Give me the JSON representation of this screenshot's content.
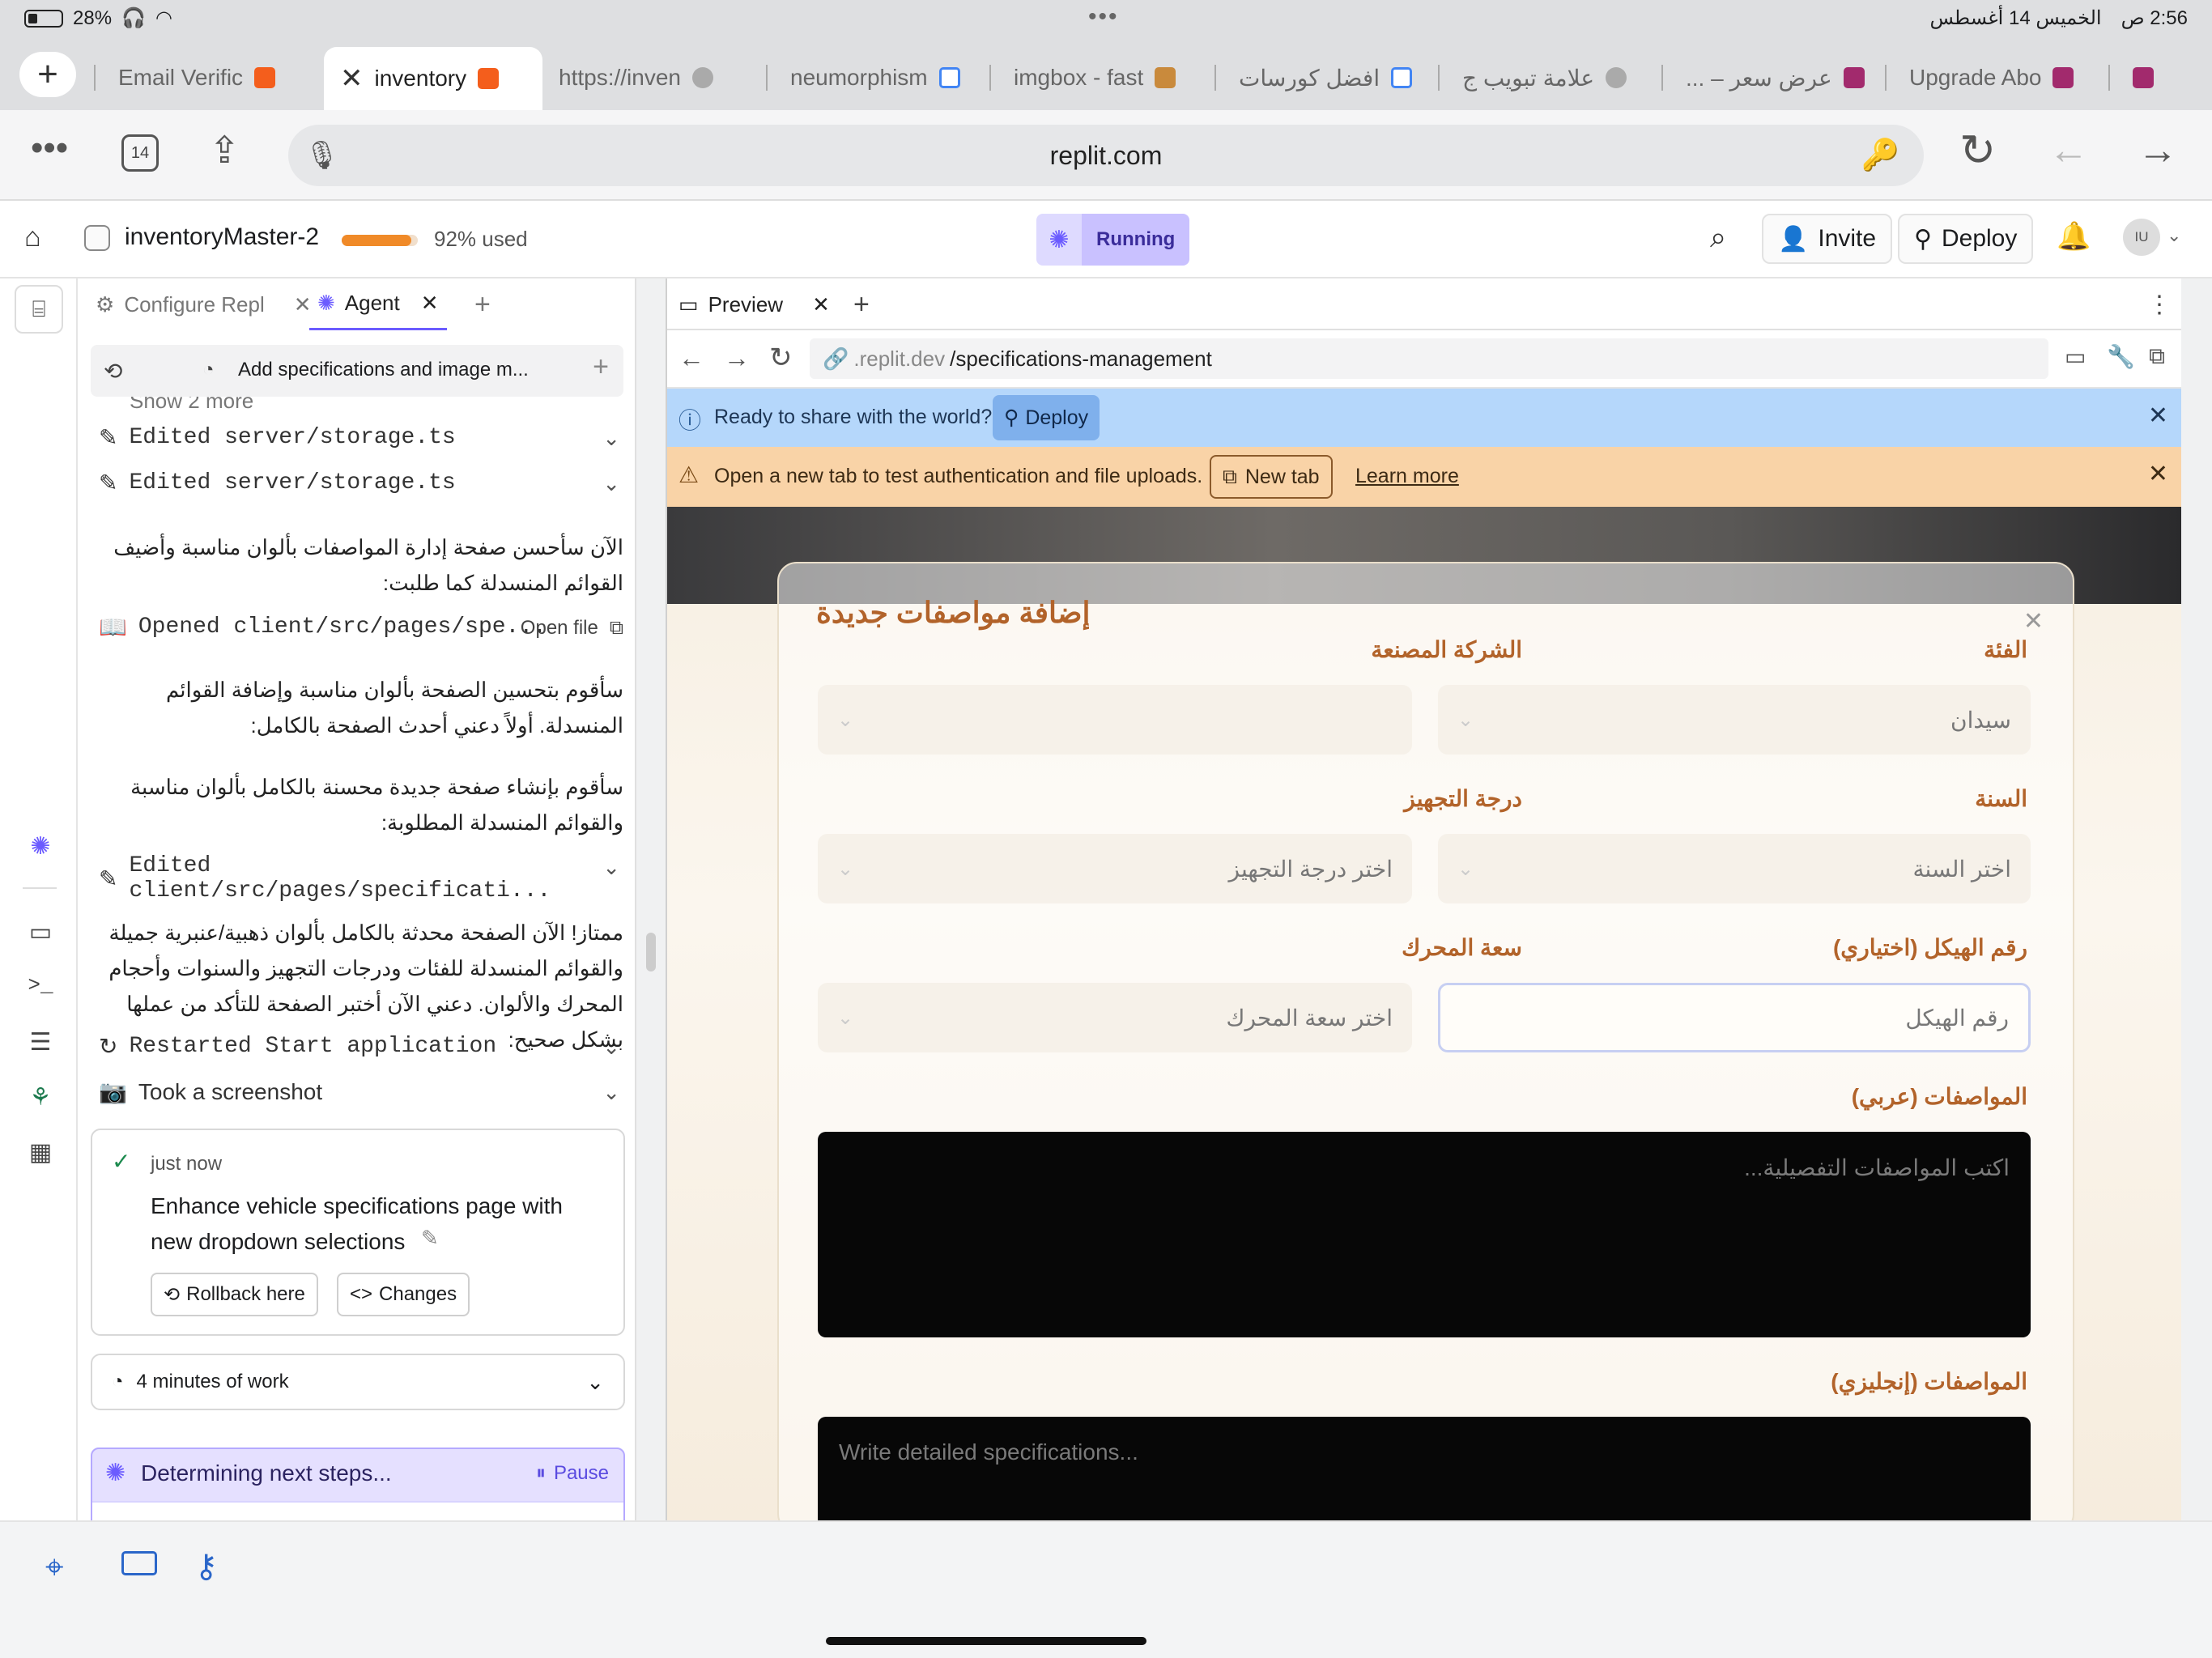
{
  "status_bar": {
    "battery_pct": "28%",
    "clock": "2:56 ص",
    "date": "الخميس 14 أغسطس"
  },
  "browser_tabs": [
    {
      "label": "Email Verific",
      "active": false
    },
    {
      "label": "inventory",
      "active": true
    },
    {
      "label": "https://inven",
      "active": false
    },
    {
      "label": "neumorphism",
      "active": false
    },
    {
      "label": "imgbox - fast",
      "active": false
    },
    {
      "label": "افضل كورسات",
      "active": false
    },
    {
      "label": "علامة تبويب ج",
      "active": false
    },
    {
      "label": "عرض سعر – ...",
      "active": false
    },
    {
      "label": "Upgrade Abo",
      "active": false
    }
  ],
  "url_bar": {
    "tab_count": "14",
    "url": "replit.com"
  },
  "replit_header": {
    "repl_name": "inventoryMaster-2",
    "usage_fraction": 0.92,
    "usage_label": "92% used",
    "run_status": "Running",
    "invite_label": "Invite",
    "deploy_label": "Deploy",
    "avatar_initials": "IU"
  },
  "agent_panel": {
    "tabs": [
      {
        "label": "Configure Repl"
      },
      {
        "label": "Agent"
      }
    ],
    "history_title": "Add specifications and image m...",
    "show_more": "Show 2 more",
    "feed": {
      "edit1": "Edited server/storage.ts",
      "edit2": "Edited server/storage.ts",
      "msg1": "الآن سأحسن صفحة إدارة المواصفات بألوان مناسبة وأضيف القوائم المنسدلة كما طلبت:",
      "opened": "Opened client/src/pages/spe...",
      "open_file": "Open file",
      "msg2": "سأقوم بتحسين الصفحة بألوان مناسبة وإضافة القوائم المنسدلة. أولاً دعني أحدث الصفحة بالكامل:",
      "msg3": "سأقوم بإنشاء صفحة جديدة محسنة بالكامل بألوان مناسبة والقوائم المنسدلة المطلوبة:",
      "edit3": "Edited client/src/pages/specificati...",
      "msg4": "ممتاز! الآن الصفحة محدثة بالكامل بألوان ذهبية/عنبرية جميلة والقوائم المنسدلة للفئات ودرجات التجهيز والسنوات وأحجام المحرك والألوان. دعني الآن أختبر الصفحة للتأكد من عملها بشكل صحيح:",
      "restarted": "Restarted Start application",
      "screenshot": "Took a screenshot"
    },
    "checkpoint": {
      "time": "just now",
      "title": "Enhance vehicle specifications page with new dropdown selections",
      "rollback": "Rollback here",
      "changes": "Changes"
    },
    "work_summary": "4 minutes of work",
    "status": {
      "text": "Determining next steps...",
      "pause": "Pause"
    }
  },
  "preview_panel": {
    "tab_label": "Preview",
    "address_prefix": ".replit.dev",
    "address_path": "/specifications-management",
    "banner_info": "Ready to share with the world?",
    "banner_deploy": "Deploy",
    "banner_warning": "Open a new tab to test authentication and file uploads.",
    "new_tab": "New tab",
    "learn_more": "Learn more",
    "form": {
      "title": "إضافة مواصفات جديدة",
      "category_label": "الفئة",
      "category_value": "سيدان",
      "manufacturer_label": "الشركة المصنعة",
      "year_label": "السنة",
      "year_placeholder": "اختر السنة",
      "trim_label": "درجة التجهيز",
      "trim_placeholder": "اختر درجة التجهيز",
      "chassis_label": "رقم الهيكل (اختياري)",
      "chassis_placeholder": "رقم الهيكل",
      "engine_label": "سعة المحرك",
      "engine_placeholder": "اختر سعة المحرك",
      "spec_ar_label": "المواصفات (عربي)",
      "spec_ar_placeholder": "اكتب المواصفات التفصيلية...",
      "spec_en_label": "المواصفات (إنجليزي)",
      "spec_en_placeholder": "Write detailed specifications..."
    }
  },
  "colors": {
    "accent_purple": "#6b5bff",
    "running_badge": "#c9c1ff",
    "info_banner": "#b5d7fb",
    "warning_banner": "#f9d3a7",
    "form_label": "#b2632a",
    "usage_bar": "#f08a28"
  }
}
